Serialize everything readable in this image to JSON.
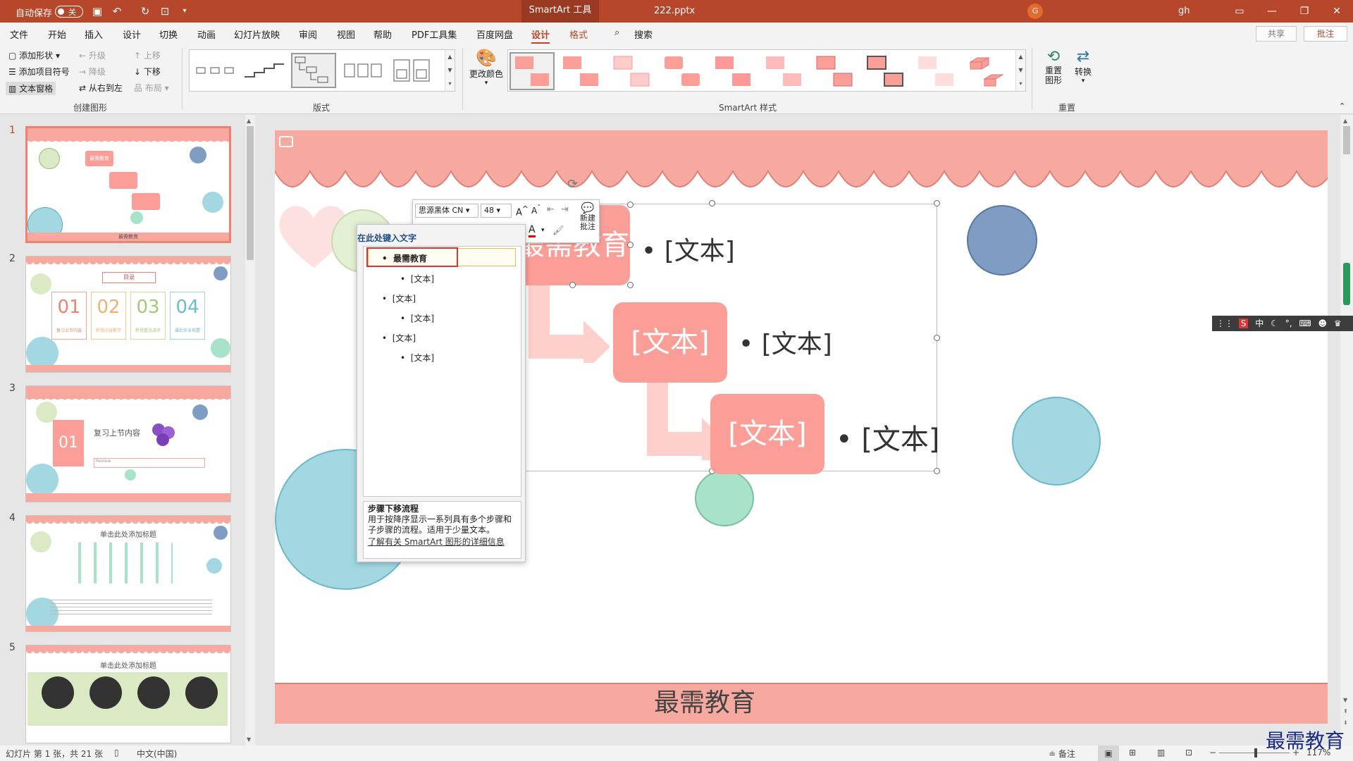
{
  "titlebar": {
    "autosave_label": "自动保存",
    "autosave_state": "关",
    "context_tab": "SmartArt 工具",
    "filename": "222.pptx",
    "user": "gh",
    "user_initial": "G"
  },
  "tabs": [
    "文件",
    "开始",
    "插入",
    "设计",
    "切换",
    "动画",
    "幻灯片放映",
    "审阅",
    "视图",
    "帮助",
    "PDF工具集",
    "百度网盘",
    "设计",
    "格式"
  ],
  "search_label": "搜索",
  "share_label": "共享",
  "comment_label": "批注",
  "ribbon": {
    "create": {
      "add_shape": "添加形状",
      "add_bullet": "添加项目符号",
      "text_pane": "文本窗格",
      "promote": "升级",
      "demote": "降级",
      "rtl": "从右到左",
      "move_up": "上移",
      "move_down": "下移",
      "layout": "布局",
      "label": "创建图形"
    },
    "layouts_label": "版式",
    "change_colors": "更改颜色",
    "styles_label": "SmartArt 样式",
    "reset_graphic": "重置图形",
    "convert": "转换",
    "reset_label": "重置"
  },
  "slides": [
    {
      "num": "1",
      "title": "最需教育",
      "box1": "最需教育",
      "footer": "最需教育"
    },
    {
      "num": "2",
      "title": "目录",
      "items": [
        "01",
        "02",
        "03",
        "04"
      ],
      "captions": [
        "复习上节内容",
        "新授内容教学",
        "新授重点讲评",
        "课后作业布置"
      ]
    },
    {
      "num": "3",
      "badge": "01",
      "heading": "复习上节内容",
      "sub": "Review"
    },
    {
      "num": "4",
      "title": "单击此处添加标题"
    },
    {
      "num": "5",
      "title": "单击此处添加标题"
    }
  ],
  "minitoolbar": {
    "font": "思源黑体 CN",
    "size": "48",
    "new_comment": "新建\n批注"
  },
  "textpane": {
    "title": "在此处键入文字",
    "lines": [
      {
        "text": "最需教育",
        "level": 1
      },
      {
        "text": "[文本]",
        "level": 2
      },
      {
        "text": "[文本]",
        "level": 1
      },
      {
        "text": "[文本]",
        "level": 2
      },
      {
        "text": "[文本]",
        "level": 1
      },
      {
        "text": "[文本]",
        "level": 2
      }
    ],
    "desc_title": "步骤下移流程",
    "desc_body": "用于按降序显示一系列具有多个步骤和子步骤的流程。适用于少量文本。",
    "desc_link": "了解有关 SmartArt 图形的详细信息"
  },
  "smartart": {
    "box1": "最需教育",
    "box2": "[文本]",
    "box3": "[文本]",
    "bullet1": "[文本]",
    "bullet2": "[文本]",
    "bullet3": "[文本]"
  },
  "slide_footer": "最需教育",
  "statusbar": {
    "slide_info": "幻灯片 第 1 张，共 21 张",
    "language": "中文(中国)",
    "notes": "备注",
    "zoom": "117%"
  },
  "ime": {
    "mode": "中"
  },
  "watermark": "最需教育",
  "colors": {
    "accent": "#b7472a",
    "box": "#fb9e98",
    "scallop": "#f7a9a0"
  }
}
